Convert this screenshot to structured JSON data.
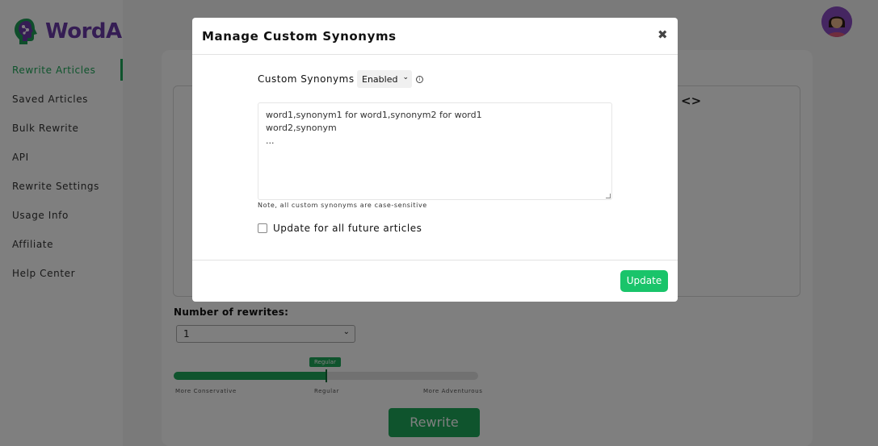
{
  "app": {
    "logo_text": "WordAi"
  },
  "sidebar": {
    "items": [
      {
        "label": "Rewrite Articles",
        "active": true
      },
      {
        "label": "Saved Articles"
      },
      {
        "label": "Bulk Rewrite"
      },
      {
        "label": "API"
      },
      {
        "label": "Rewrite Settings"
      },
      {
        "label": "Usage Info"
      },
      {
        "label": "Affiliate"
      },
      {
        "label": "Help Center"
      }
    ]
  },
  "main": {
    "rewrites": {
      "label": "Number of rewrites:",
      "value": "1"
    },
    "slider": {
      "bubble": "Regular",
      "value_fraction": 0.5,
      "labels": [
        "More Conservative",
        "Regular",
        "More Adventurous"
      ]
    },
    "rewrite_button": "Rewrite"
  },
  "modal": {
    "title": "Manage Custom Synonyms",
    "close_icon": "close-icon",
    "custom_synonyms_label": "Custom Synonyms",
    "custom_synonyms_value": "Enabled",
    "synonyms_lines": [
      "word1,synonym1 for word1,synonym2 for word1",
      "word2,synonym",
      "..."
    ],
    "note": "Note, all custom synonyms are case-sensitive",
    "future_checkbox": {
      "label": "Update for all future articles",
      "checked": false
    },
    "update_button": "Update"
  },
  "colors": {
    "brand_green": "#1fa85a",
    "update_green": "#19c46a",
    "brand_purple": "#6b3aa8",
    "overlay": "rgba(0,0,0,0.5)"
  }
}
